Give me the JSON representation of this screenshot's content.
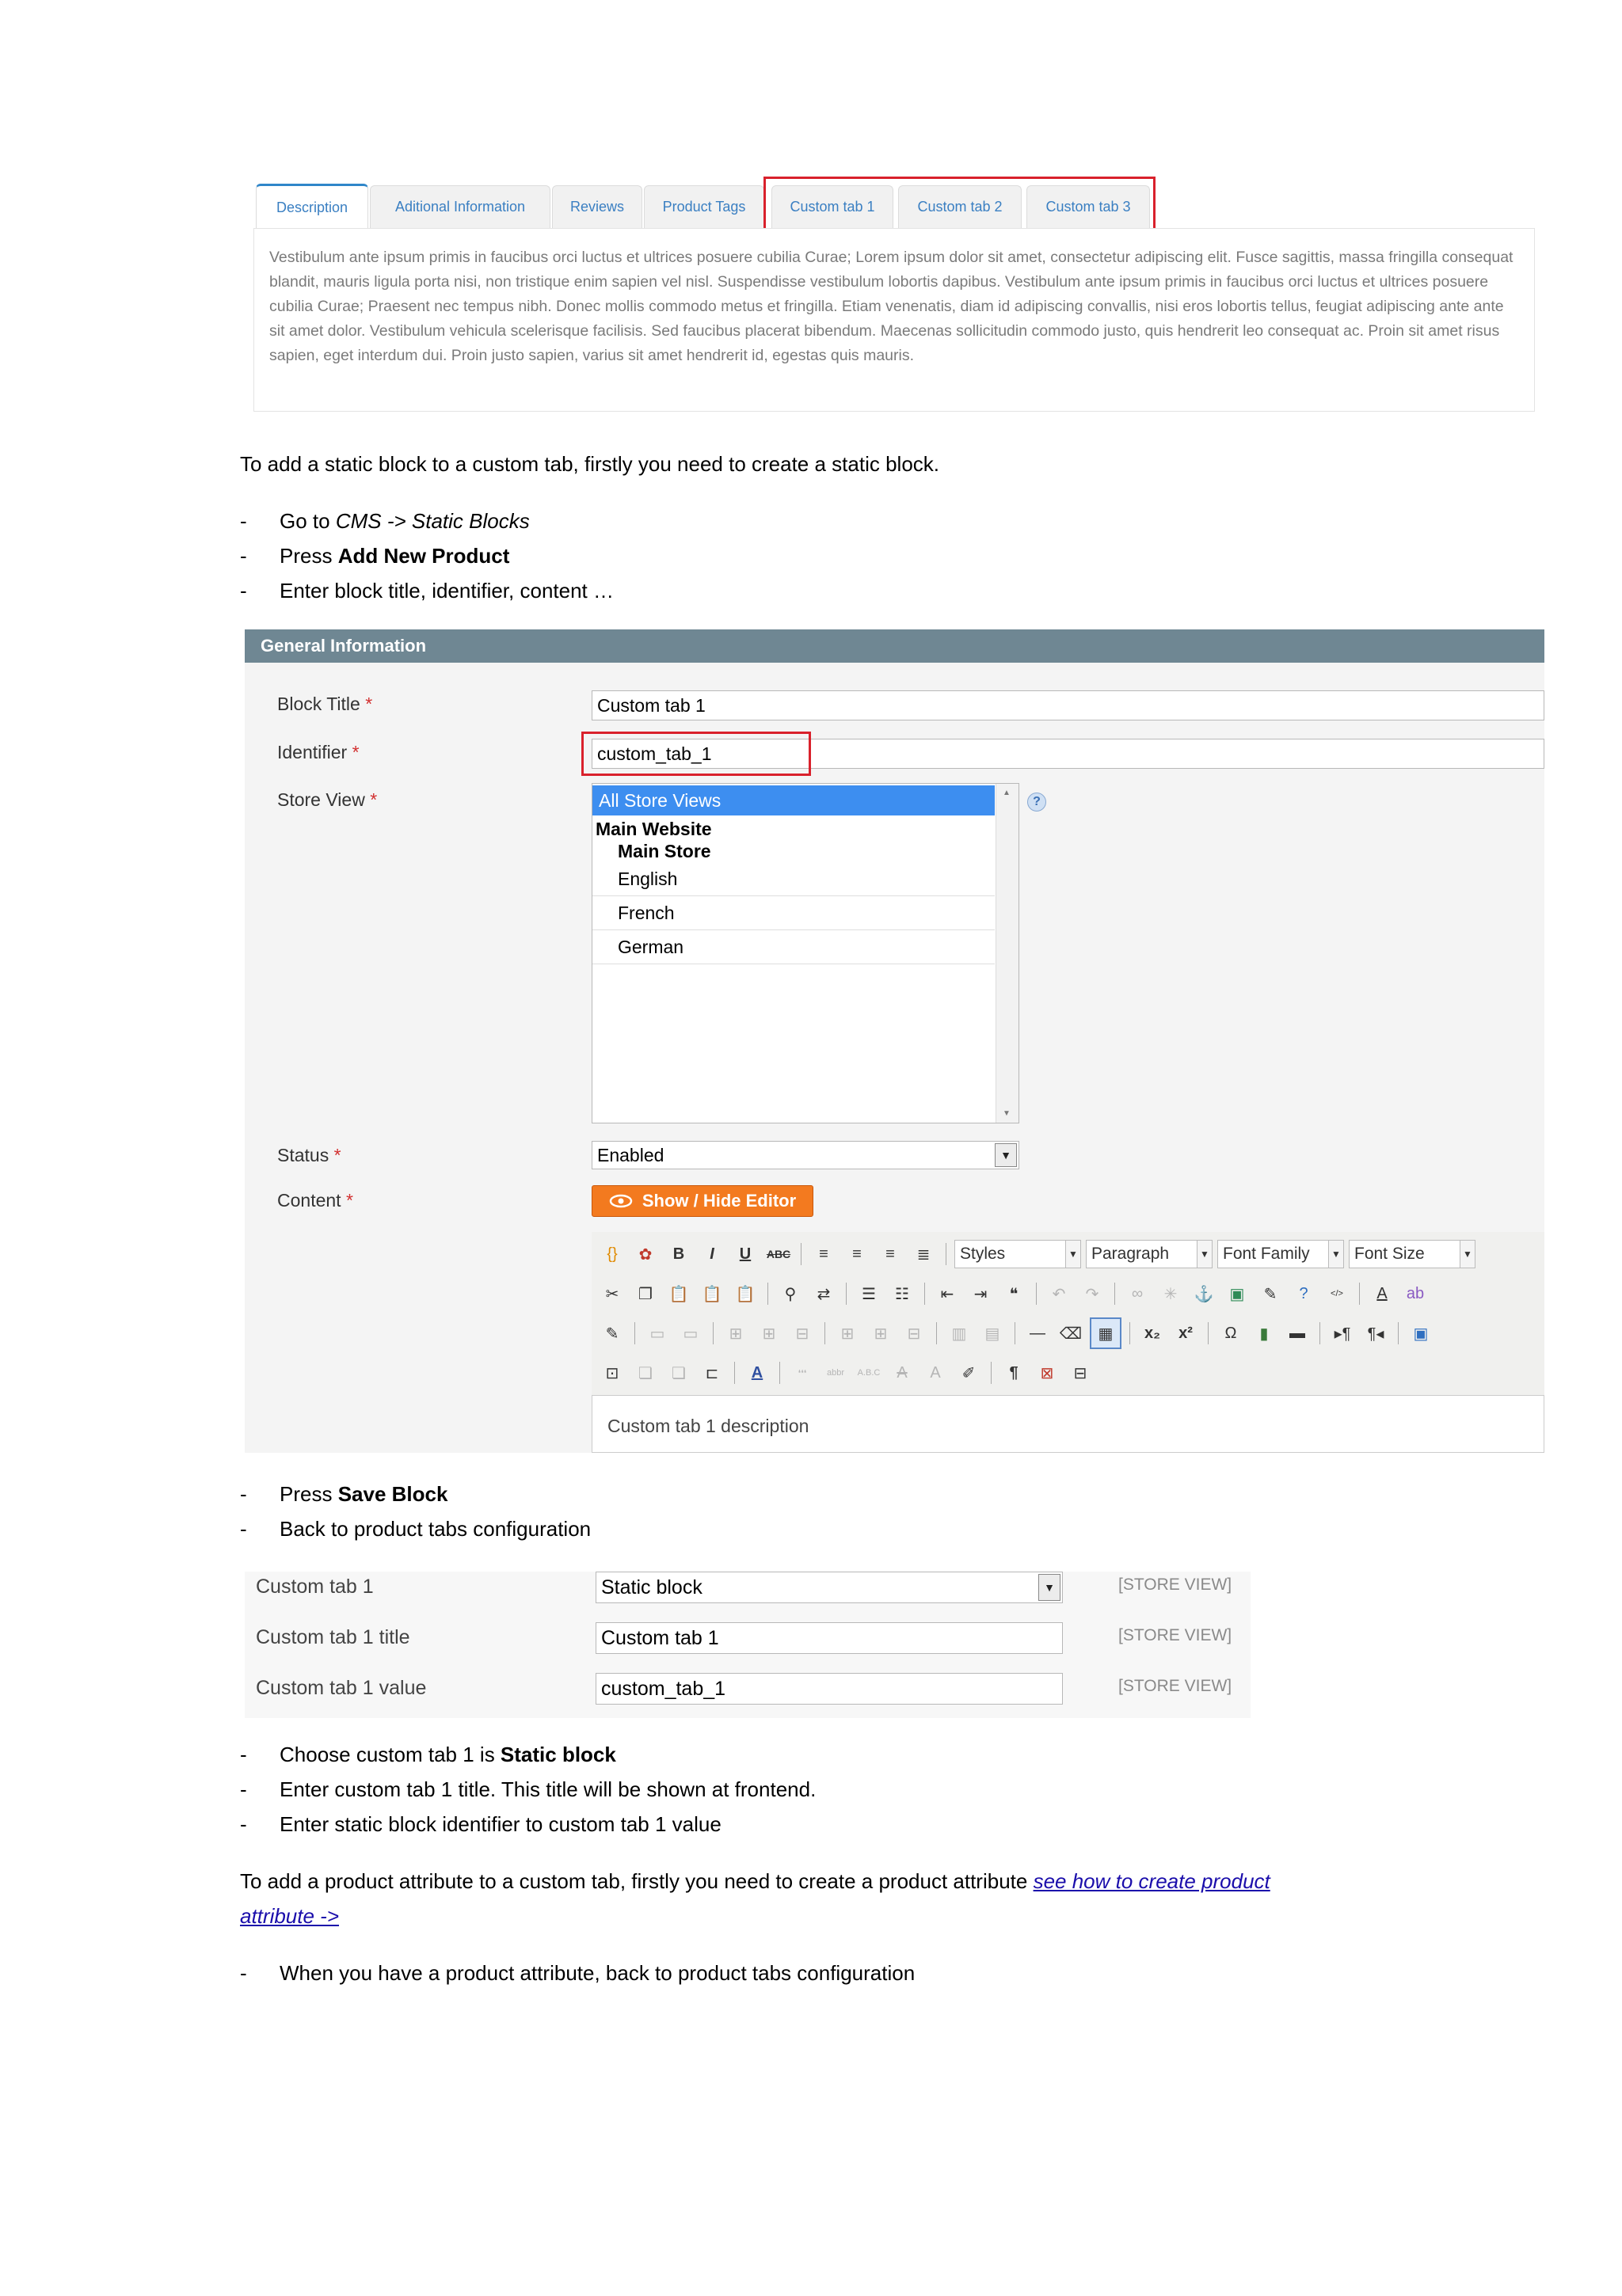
{
  "product_tabs": {
    "tabs": [
      "Description",
      "Aditional Information",
      "Reviews",
      "Product Tags",
      "Custom tab 1",
      "Custom tab 2",
      "Custom tab 3"
    ],
    "description_text": "Vestibulum ante ipsum primis in faucibus orci luctus et ultrices posuere cubilia Curae; Lorem ipsum dolor sit amet, consectetur adipiscing elit. Fusce sagittis, massa fringilla consequat blandit, mauris ligula porta nisi, non tristique enim sapien vel nisl. Suspendisse vestibulum lobortis dapibus. Vestibulum ante ipsum primis in faucibus orci luctus et ultrices posuere cubilia Curae; Praesent nec tempus nibh. Donec mollis commodo metus et fringilla. Etiam venenatis, diam id adipiscing convallis, nisi eros lobortis tellus, feugiat adipiscing ante ante sit amet dolor. Vestibulum vehicula scelerisque facilisis. Sed faucibus placerat bibendum. Maecenas sollicitudin commodo justo, quis hendrerit leo consequat ac. Proin sit amet risus sapien, eget interdum dui. Proin justo sapien, varius sit amet hendrerit id, egestas quis mauris."
  },
  "doc": {
    "intro_static": "To add a static block to a custom tab, firstly you need to create a static block.",
    "steps1": [
      {
        "pre": "Go to ",
        "em": "CMS -> Static Blocks",
        "post": ""
      },
      {
        "pre": "Press ",
        "strong": "Add New Product",
        "post": ""
      },
      {
        "pre": "Enter block title, identifier, content …",
        "post": ""
      }
    ],
    "steps2": [
      {
        "pre": "Press ",
        "strong": "Save Block"
      },
      {
        "pre": "Back to product tabs configuration"
      }
    ],
    "steps3": [
      {
        "pre": "Choose custom tab 1 is ",
        "strong": "Static block"
      },
      {
        "pre": "Enter custom tab 1 title. This title will be shown at frontend."
      },
      {
        "pre": "Enter static block identifier to custom tab 1 value"
      }
    ],
    "intro_attr": "To add a product attribute to a custom tab, firstly you need to create a product attribute ",
    "attr_link_1": "see how to create product",
    "attr_link_2": "attribute ->",
    "steps4": [
      {
        "pre": "When you have a product attribute, back to product tabs configuration"
      }
    ],
    "dash": "-"
  },
  "form": {
    "header": "General Information",
    "required_mark": "*",
    "block_title_label": "Block Title",
    "block_title_value": "Custom tab 1",
    "identifier_label": "Identifier",
    "identifier_value": "custom_tab_1",
    "store_view_label": "Store View",
    "store_views": {
      "selected": "All Store Views",
      "website": "Main Website",
      "store": "Main Store",
      "views": [
        "English",
        "French",
        "German"
      ]
    },
    "status_label": "Status",
    "status_value": "Enabled",
    "content_label": "Content",
    "editor_button": "Show / Hide Editor",
    "editor_selects": [
      "Styles",
      "Paragraph",
      "Font Family",
      "Font Size"
    ],
    "editor_content": "Custom tab 1 description",
    "help_glyph": "?"
  },
  "config": {
    "rows": [
      {
        "label": "Custom tab 1",
        "value": "Static block",
        "scope": "[STORE VIEW]"
      },
      {
        "label": "Custom tab 1 title",
        "value": "Custom tab 1",
        "scope": "[STORE VIEW]"
      },
      {
        "label": "Custom tab 1 value",
        "value": "custom_tab_1",
        "scope": "[STORE VIEW]"
      }
    ]
  },
  "colors": {
    "highlight_red": "#d9212c",
    "tab_link": "#3a7fc2",
    "form_header": "#6f8793",
    "orange_button": "#f37a1f",
    "select_blue": "#3d8ef0",
    "link_blue": "#1a0dab"
  }
}
